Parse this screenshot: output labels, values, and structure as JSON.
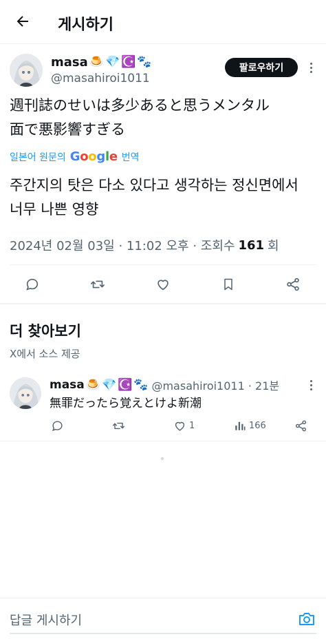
{
  "header": {
    "title": "게시하기"
  },
  "post": {
    "author": {
      "name": "masa",
      "emojis": [
        "🍮",
        "💎",
        "☪️",
        "🐾"
      ],
      "handle": "@masahiroi1011"
    },
    "follow_label": "팔로우하기",
    "text_line1": "週刊誌のせいは多少あると思うメンタル",
    "text_line2": "面で悪影響すぎる",
    "translate_prefix": "일본어 원문의",
    "translate_suffix": "번역",
    "google_logo": {
      "G": "G",
      "o1": "o",
      "o2": "o",
      "g": "g",
      "l": "l",
      "e": "e"
    },
    "translated_line1": "주간지의 탓은 다소 있다고 생각하는 정신면에서",
    "translated_line2": "너무 나쁜 영향",
    "timestamp": "2024년 02월 03일 · 11:02 오후 · 조회수",
    "views_count": "161",
    "views_suffix": "회",
    "actions": [
      "reply-icon",
      "repost-icon",
      "like-icon",
      "bookmark-icon",
      "share-icon"
    ]
  },
  "more_section": {
    "title": "더 찾아보기",
    "subtitle": "X에서 소스 제공"
  },
  "reply": {
    "name": "masa",
    "emojis": [
      "🍮",
      "💎",
      "☪️",
      "🐾"
    ],
    "handle_time": "@masahiroi1011 · 21분",
    "text": "無罪だったら覚えとけよ新潮",
    "likes": "1",
    "views": "166"
  },
  "compose": {
    "placeholder": "답글 게시하기"
  },
  "colors": {
    "text": "#0f1419",
    "secondary": "#536471",
    "accent": "#1d9bf0",
    "border": "#eff3f4"
  }
}
